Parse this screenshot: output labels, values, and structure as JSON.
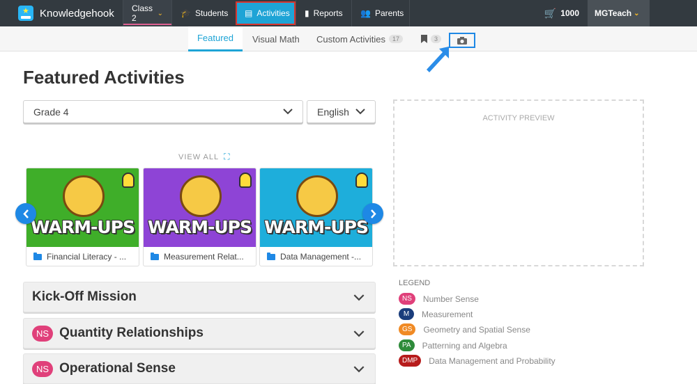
{
  "header": {
    "brand": "Knowledgehook",
    "class_selector": "Class 2",
    "nav": [
      {
        "label": "Students",
        "icon": "graduation-cap-icon"
      },
      {
        "label": "Activities",
        "icon": "document-icon"
      },
      {
        "label": "Reports",
        "icon": "bar-chart-icon"
      },
      {
        "label": "Parents",
        "icon": "users-icon"
      }
    ],
    "cart_count": "1000",
    "user": "MGTeach"
  },
  "subnav": {
    "tabs": [
      {
        "label": "Featured"
      },
      {
        "label": "Visual Math"
      },
      {
        "label": "Custom Activities",
        "count": "17"
      },
      {
        "label": "",
        "count": "3",
        "icon": "bookmark-icon"
      },
      {
        "label": "",
        "icon": "camera-icon"
      }
    ]
  },
  "main": {
    "title": "Featured Activities",
    "grade_select": "Grade 4",
    "language_select": "English",
    "view_all": "VIEW ALL",
    "cards": [
      {
        "image_text": "WARM-UPS",
        "label": "Financial Literacy - ...",
        "color": "#3fae29"
      },
      {
        "image_text": "WARM-UPS",
        "label": "Measurement Relat...",
        "color": "#8e44d6"
      },
      {
        "image_text": "WARM-UPS",
        "label": "Data Management -...",
        "color": "#1eaedb"
      }
    ],
    "sections": [
      {
        "title": "Kick-Off Mission",
        "badge": ""
      },
      {
        "title": "Quantity Relationships",
        "badge": "NS"
      },
      {
        "title": "Operational Sense",
        "badge": "NS"
      }
    ]
  },
  "preview": {
    "label": "ACTIVITY PREVIEW"
  },
  "legend": {
    "title": "LEGEND",
    "items": [
      {
        "code": "NS",
        "label": "Number Sense",
        "color": "#e0407a"
      },
      {
        "code": "M",
        "label": "Measurement",
        "color": "#1a3d7c"
      },
      {
        "code": "GS",
        "label": "Geometry and Spatial Sense",
        "color": "#f08a24"
      },
      {
        "code": "PA",
        "label": "Patterning and Algebra",
        "color": "#2e8b3a"
      },
      {
        "code": "DMP",
        "label": "Data Management and Probability",
        "color": "#b71c1c"
      }
    ]
  }
}
